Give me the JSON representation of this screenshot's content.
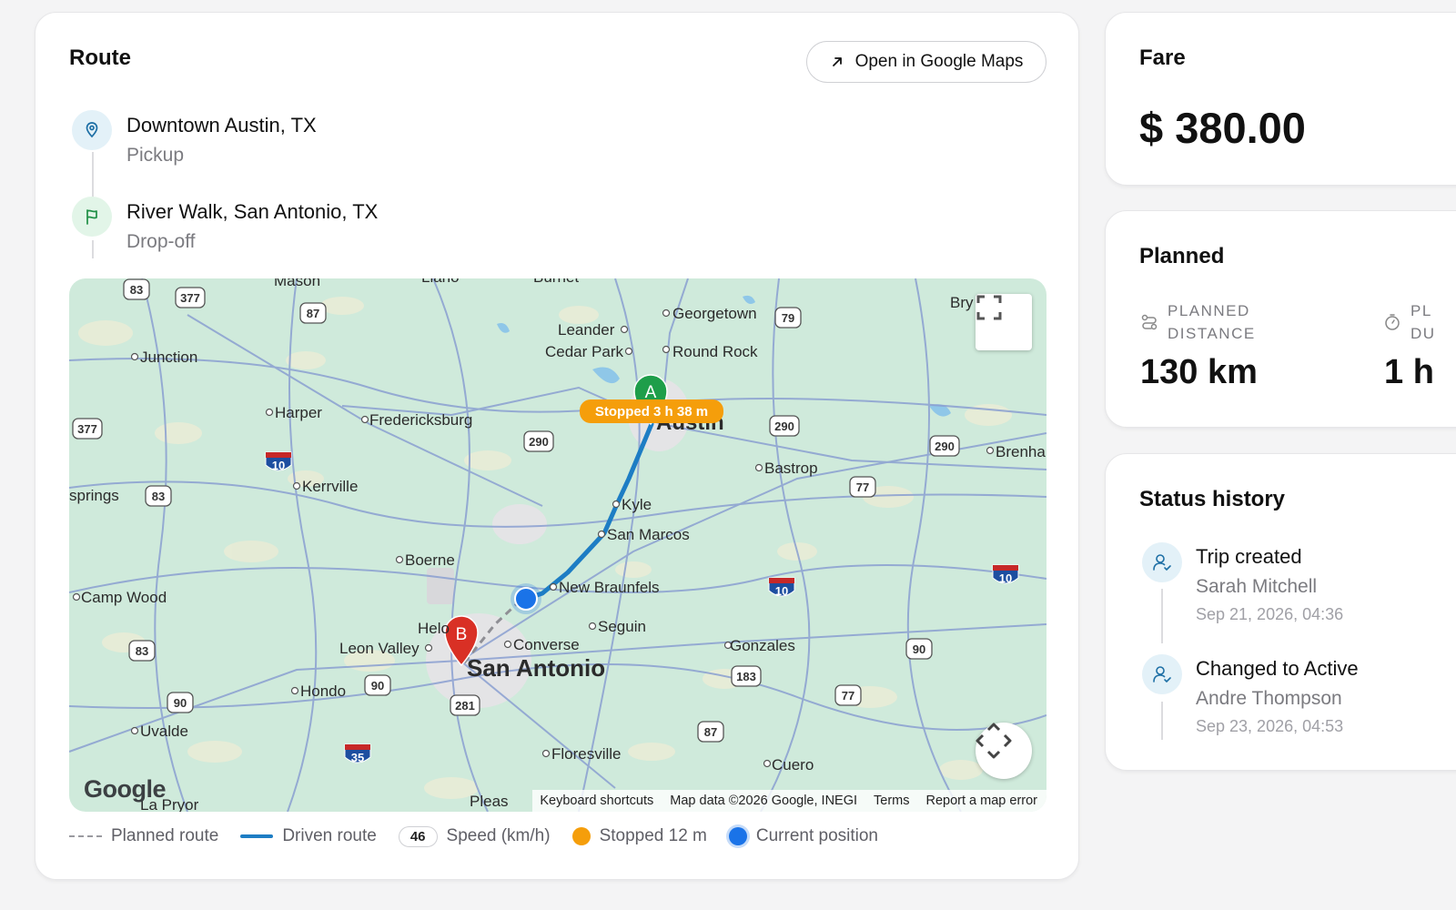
{
  "route": {
    "title": "Route",
    "open_maps_label": "Open in Google Maps",
    "pickup": {
      "name": "Downtown Austin, TX",
      "type": "Pickup"
    },
    "dropoff": {
      "name": "River Walk, San Antonio, TX",
      "type": "Drop-off"
    },
    "map": {
      "marker_a": "A",
      "marker_b": "B",
      "stopped_label": "Stopped 3 h 38 m",
      "google_logo": "Google",
      "attribution": {
        "keyboard": "Keyboard shortcuts",
        "map_data": "Map data ©2026 Google, INEGI",
        "terms": "Terms",
        "report": "Report a map error"
      },
      "places": {
        "georgetown": "Georgetown",
        "leander": "Leander",
        "cedar_park": "Cedar Park",
        "round_rock": "Round Rock",
        "junction": "Junction",
        "harper": "Harper",
        "fredericksburg": "Fredericksburg",
        "austin": "Austin",
        "bastrop": "Bastrop",
        "brenham": "Brenha",
        "bryan": "Bry",
        "kerrville": "Kerrville",
        "springs": "springs",
        "kyle": "Kyle",
        "san_marcos": "San Marcos",
        "boerne": "Boerne",
        "new_braunfels": "New Braunfels",
        "camp_wood": "Camp Wood",
        "helotes": "Helo",
        "leon_valley": "Leon Valley",
        "converse": "Converse",
        "seguin": "Seguin",
        "gonzales": "Gonzales",
        "san_antonio": "San Antonio",
        "hondo": "Hondo",
        "uvalde": "Uvalde",
        "floresville": "Floresville",
        "cuero": "Cuero",
        "pleasanton": "Pleas",
        "la_pryor": "La Pryor",
        "mason": "Mason",
        "llano": "Llano",
        "burnet": "Burnet"
      },
      "shields": {
        "us83a": "83",
        "us377a": "377",
        "us87a": "87",
        "us79": "79",
        "us377b": "377",
        "us290a": "290",
        "us290b": "290",
        "us290c": "290",
        "i10a": "10",
        "us83b": "83",
        "us77a": "77",
        "i10b": "10",
        "i10c": "10",
        "i35": "35",
        "us83c": "83",
        "us90a": "90",
        "us281": "281",
        "us90b": "90",
        "us183": "183",
        "us77b": "77",
        "us90c": "90",
        "us87b": "87"
      }
    },
    "legend": {
      "planned": "Planned route",
      "driven": "Driven route",
      "speed_value": "46",
      "speed": "Speed (km/h)",
      "stopped": "Stopped 12 m",
      "current": "Current position"
    }
  },
  "fare": {
    "title": "Fare",
    "amount": "$ 380.00"
  },
  "planned": {
    "title": "Planned",
    "distance_label_1": "PLANNED",
    "distance_label_2": "DISTANCE",
    "distance_value": "130 km",
    "duration_label_1": "PL",
    "duration_label_2": "DU",
    "duration_value": "1 h"
  },
  "status_history": {
    "title": "Status history",
    "entries": [
      {
        "title": "Trip created",
        "user": "Sarah Mitchell",
        "date": "Sep 21, 2026, 04:36"
      },
      {
        "title": "Changed to Active",
        "user": "Andre Thompson",
        "date": "Sep 23, 2026, 04:53"
      }
    ]
  },
  "colors": {
    "accent_blue": "#1d7dc4",
    "marker_green": "#1e9e4a",
    "marker_red": "#d93025",
    "stopped_orange": "#f59e0b",
    "current_blue": "#1a73e8"
  }
}
